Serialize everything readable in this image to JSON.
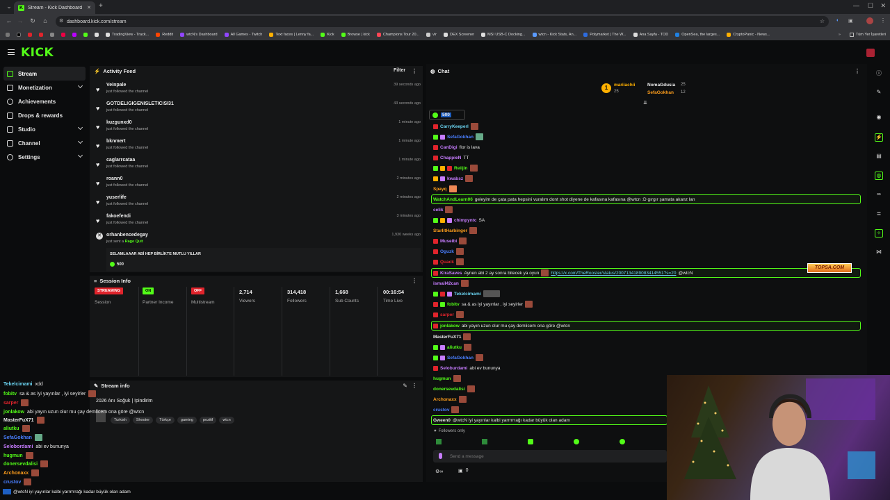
{
  "browser": {
    "tab_title": "Stream - Kick Dashboard",
    "new_tab": "+",
    "url": "dashboard.kick.com/stream",
    "bookmarks": [
      "TradingView - Track...",
      "Reddit",
      "wtcN's Dashboard",
      "All Games - Twitch",
      "Text faces | Lenny fa...",
      "Kick",
      "Browse | kick",
      "Champions Tour 20...",
      "vlr",
      "DEX Screener",
      "MSI USB-C Docking...",
      "wtcn - Kick Stats, An...",
      "Polymarket | The W...",
      "Ana Sayfa - TOD",
      "OpenSea, the larges...",
      "CryptoPanic - News..."
    ],
    "all_bookmarks": "Tüm Yer İşaretleri"
  },
  "app": {
    "logo": "KICK"
  },
  "sidebar": {
    "items": [
      {
        "label": "Stream"
      },
      {
        "label": "Monetization"
      },
      {
        "label": "Achievements"
      },
      {
        "label": "Drops & rewards"
      },
      {
        "label": "Studio"
      },
      {
        "label": "Channel"
      },
      {
        "label": "Settings"
      }
    ]
  },
  "activity": {
    "title": "Activity Feed",
    "filter": "Filter",
    "items": [
      {
        "name": "Veinpale",
        "sub": "just followed the channel",
        "time": "39 seconds ago"
      },
      {
        "name": "GOTDELIGIGENISLETICISI31",
        "sub": "just followed the channel",
        "time": "43 seconds ago"
      },
      {
        "name": "kuzgunxd0",
        "sub": "just followed the channel",
        "time": "1 minute ago"
      },
      {
        "name": "bknmert",
        "sub": "just followed the channel",
        "time": "1 minute ago"
      },
      {
        "name": "caglarrcataa",
        "sub": "just followed the channel",
        "time": "1 minute ago"
      },
      {
        "name": "roann0",
        "sub": "just followed the channel",
        "time": "2 minutes ago"
      },
      {
        "name": "yuserlife",
        "sub": "just followed the channel",
        "time": "2 minutes ago"
      },
      {
        "name": "fakoefendi",
        "sub": "just followed the channel",
        "time": "3 minutes ago"
      },
      {
        "name": "orhanbencedegay",
        "sub": "just sent a",
        "gift": "Rage Quit",
        "time": "1,930 weeks ago"
      }
    ],
    "gift_message": "SELAMLAAAR ABİ HEP BİRLİKTE MUTLU YILLAR",
    "gift_amount": "500"
  },
  "session": {
    "title": "Session Info",
    "stats": [
      {
        "badge": "STREAMING",
        "label": "Session",
        "color": "#e0242c"
      },
      {
        "badge": "ON",
        "label": "Partner Income",
        "color": "#53fc18"
      },
      {
        "badge": "OFF",
        "label": "Multistream",
        "color": "#e0242c"
      },
      {
        "value": "2,714",
        "label": "Viewers"
      },
      {
        "value": "314,418",
        "label": "Followers"
      },
      {
        "value": "1,668",
        "label": "Sub Counts"
      },
      {
        "value": "00:16:54",
        "label": "Time Live"
      }
    ]
  },
  "stream_info": {
    "title": "Stream info",
    "stream_title": "2026 Anı Soğuk | !pindirim",
    "tags": [
      "Turkish",
      "Shooter",
      "Türkçe",
      "gaming",
      "pozitif",
      "wtcn"
    ]
  },
  "chat": {
    "title": "Chat",
    "top_gifters": [
      {
        "name": "mariiachii",
        "count": "25"
      },
      {
        "name": "NomaGdusia",
        "count": "25"
      },
      {
        "name": "SefaGokhan",
        "count": "12"
      }
    ],
    "pinned_amount": "500",
    "messages": [
      {
        "user": "CarryKeeperl",
        "text": "",
        "color": "#6ad3f0"
      },
      {
        "user": "SefaGokhan",
        "text": "",
        "color": "#4a7fff"
      },
      {
        "user": "CanDigi",
        "text": "flor is lava",
        "color": "#c77dff"
      },
      {
        "user": "ChappieN",
        "text": "TT",
        "color": "#c77dff"
      },
      {
        "user": "Reiijin",
        "text": "",
        "color": "#53fc18"
      },
      {
        "user": "kwabsz",
        "text": "",
        "color": "#c77dff"
      },
      {
        "user": "Spayq",
        "text": "",
        "color": "#ff9f1c"
      },
      {
        "user": "WatchAndLearn06",
        "text": "geleyim de çata pata hepsini vuralım dont shot diyene de kafasına kafasına @wtcn :D gırgır şamata akanz lan",
        "color": "#53fc18",
        "highlight": true
      },
      {
        "user": "celik",
        "text": "",
        "color": "#c77dff"
      },
      {
        "user": "chimpyntc",
        "text": "SA",
        "color": "#c77dff"
      },
      {
        "user": "StarlitHarbinger",
        "text": "",
        "color": "#ff9f1c"
      },
      {
        "user": "Museibi",
        "text": "",
        "color": "#c77dff"
      },
      {
        "user": "Oguzk",
        "text": "",
        "color": "#4a7fff"
      },
      {
        "user": "Quack",
        "text": "",
        "color": "#e0242c"
      },
      {
        "user": "KiraSaves",
        "text": "Aynen abi 2 ay sonra bitecek ya oyun",
        "link": "https://x.com/TheRooster/status/2007134189083414551?s=20",
        "mention": "@wtcN",
        "color": "#c77dff",
        "highlight": true
      },
      {
        "user": "ismail42can",
        "text": "",
        "color": "#c77dff"
      },
      {
        "user": "Tekelcimami",
        "text": "",
        "color": "#6ad3f0"
      },
      {
        "user": "fobitv",
        "text": "sa & as iyi yayınlar , iyi seyirler",
        "color": "#53fc18"
      },
      {
        "user": "sarper",
        "text": "",
        "color": "#e0242c"
      },
      {
        "user": "jonlakow",
        "text": "abi yayın uzun olur mu çay demlicem ona göre @wtcn",
        "color": "#53fc18",
        "highlight": true
      },
      {
        "user": "MasterFuX71",
        "text": "",
        "color": "#e6e6e6"
      },
      {
        "user": "aliutku",
        "text": "",
        "color": "#53fc18"
      },
      {
        "user": "SefaGokhan",
        "text": "",
        "color": "#4a7fff"
      },
      {
        "user": "Seloburdami",
        "text": "abi ev bununya",
        "color": "#c77dff"
      },
      {
        "user": "hugmun",
        "text": "",
        "color": "#53fc18"
      },
      {
        "user": "donersevdalisi",
        "text": "",
        "color": "#53fc18"
      },
      {
        "user": "Archonaxx",
        "text": "",
        "color": "#ff9f1c"
      },
      {
        "user": "crustov",
        "text": "",
        "color": "#4a7fff"
      },
      {
        "user": "Gween0",
        "text": "@wtcN iyi yayınlar kalbi yarrrrrrağı kadar büyük olan adam",
        "color": "#e6e6e6",
        "highlight": true
      }
    ],
    "followers_only": "Followers only",
    "placeholder": "Send a message",
    "footer_count": "0"
  },
  "overlay": {
    "title": "TOPSA.COM",
    "messages": [
      {
        "user": "Tekelcimami",
        "text": "xdd",
        "color": "#6ad3f0"
      },
      {
        "user": "fobitv",
        "text": "sa & as iyi yayınlar , iyi seyirler",
        "color": "#53fc18"
      },
      {
        "user": "sarper",
        "text": "",
        "color": "#e0242c"
      },
      {
        "user": "jonlakow",
        "text": "abi yayın uzun olur mu çay demlicem ona göre @wtcn",
        "color": "#53fc18"
      },
      {
        "user": "MasterFuX71",
        "text": "",
        "color": "#e6e6e6"
      },
      {
        "user": "aliutku",
        "text": "",
        "color": "#53fc18"
      },
      {
        "user": "SefaGokhan",
        "text": "",
        "color": "#4a7fff"
      },
      {
        "user": "Selobordami",
        "text": "abi ev bununya",
        "color": "#c77dff"
      },
      {
        "user": "hugmun",
        "text": "",
        "color": "#53fc18"
      },
      {
        "user": "donersevdalisi",
        "text": "",
        "color": "#53fc18"
      },
      {
        "user": "Archonaxx",
        "text": "",
        "color": "#ff9f1c"
      },
      {
        "user": "crustov",
        "text": "",
        "color": "#4a7fff"
      }
    ],
    "bottom_text": "@wtcN iyi yayınlar kalbi yarrrrrrağı kadar büyük olan adam"
  }
}
